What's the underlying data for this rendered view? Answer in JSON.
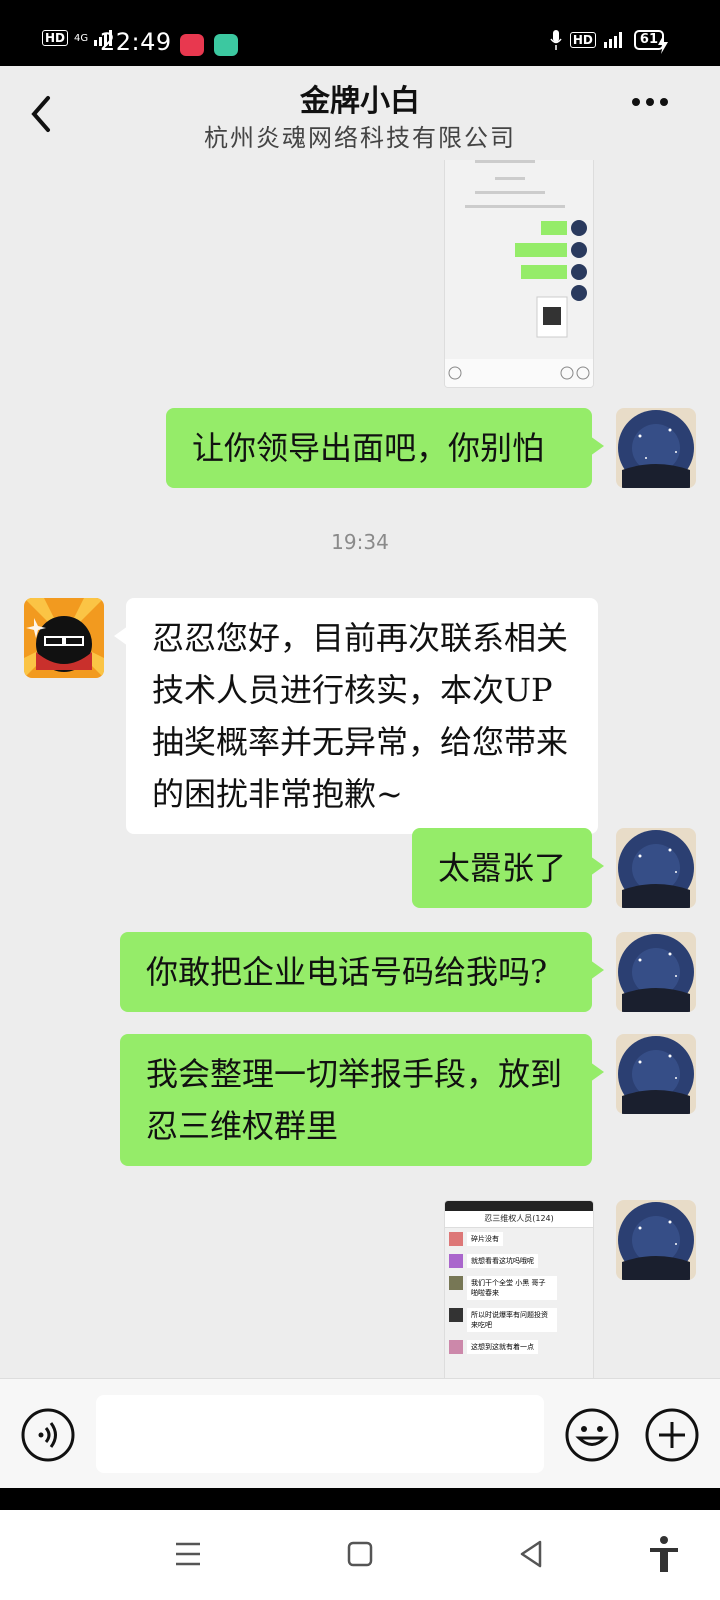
{
  "status_bar": {
    "time": "22:49",
    "hd_label": "HD",
    "net_label": "4G",
    "hd_right_label": "HD",
    "battery": "61"
  },
  "header": {
    "title": "金牌小白",
    "subtitle": "杭州炎魂网络科技有限公司"
  },
  "messages": {
    "m1": "让你领导出面吧，你别怕",
    "timestamp": "19:34",
    "m2": "忍忍您好，目前再次联系相关技术人员进行核实，本次UP抽奖概率并无异常，给您带来的困扰非常抱歉~",
    "m3": "太嚣张了",
    "m4": "你敢把企业电话号码给我吗?",
    "m5": "我会整理一切举报手段，放到忍三维权群里"
  },
  "screenshot2": {
    "header": "忍三维权人员(124)",
    "rows": [
      "碎片没有",
      "就想看看这坑吗哦呢",
      "我们干个全堂 小黑 哥子 啪啦春来",
      "所以时说爆率有问题投资来吃吧",
      "这想到这就有着一点"
    ]
  },
  "icons": {
    "back": "chevron-left-icon",
    "more": "more-dots-icon",
    "voice": "voice-icon",
    "emoji": "emoji-icon",
    "plus": "plus-icon"
  },
  "colors": {
    "outgoing_bubble": "#95ec69",
    "incoming_bubble": "#ffffff",
    "chat_bg": "#ededed"
  }
}
